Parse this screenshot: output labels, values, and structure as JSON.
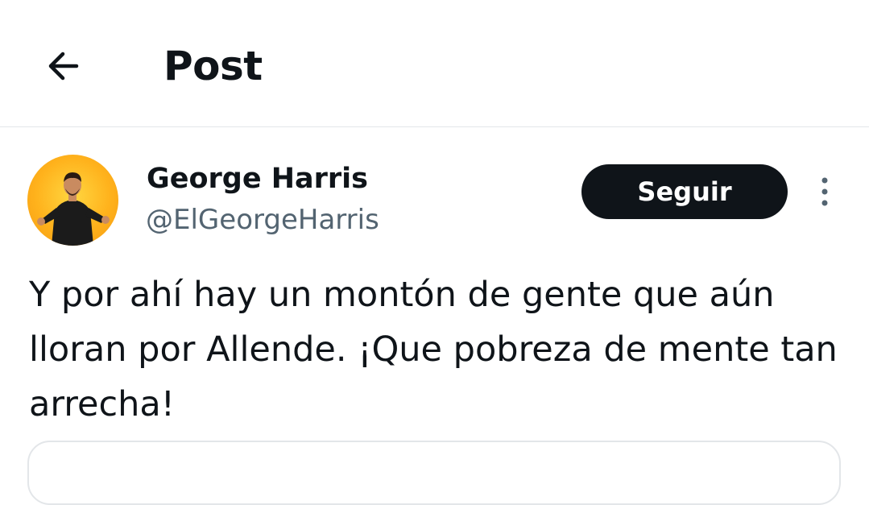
{
  "header": {
    "title": "Post",
    "back_icon": "arrow-left-icon"
  },
  "author": {
    "name": "George Harris",
    "handle": "@ElGeorgeHarris",
    "avatar_background": "#ffc21f"
  },
  "actions": {
    "follow_label": "Seguir",
    "follow_bg_color": "#0f1419",
    "more_icon": "more-vertical-icon"
  },
  "post": {
    "text": "Y por ahí hay un montón de gente que aún lloran por Allende. ¡Que pobreza de mente tan arrecha!"
  }
}
